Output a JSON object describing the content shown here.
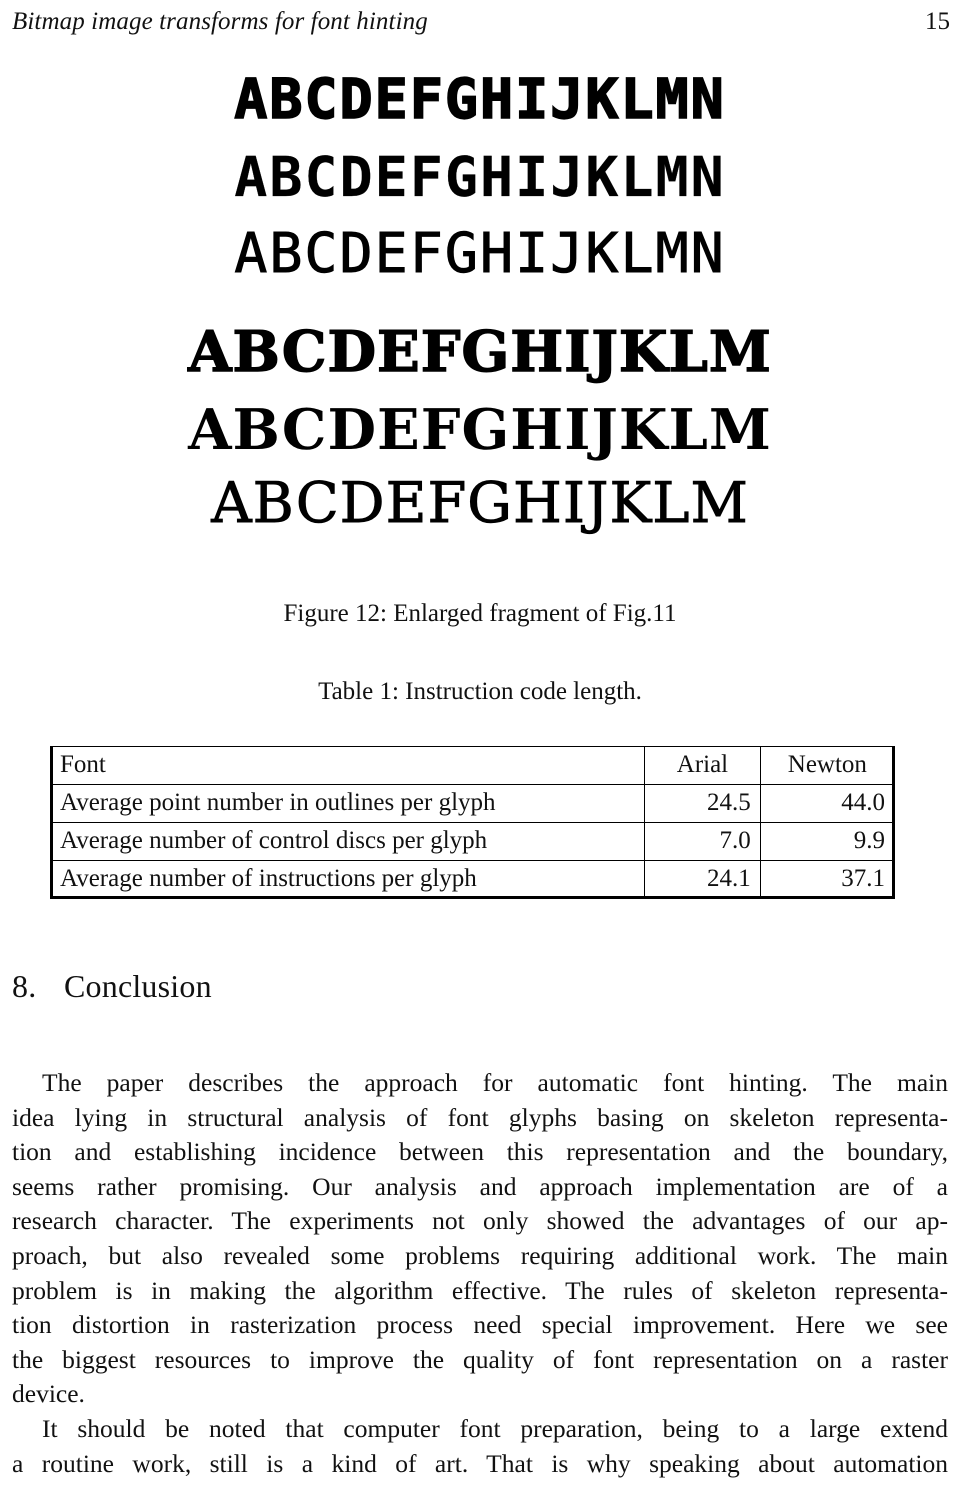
{
  "running_head": {
    "title": "Bitmap image transforms for font hinting",
    "page_number": "15"
  },
  "figure": {
    "rows": [
      {
        "text": "ABCDEFGHIJKLMN",
        "style": "sans-bold"
      },
      {
        "text": "ABCDEFGHIJKLMN",
        "style": "sans-medium"
      },
      {
        "text": "ABCDEFGHIJKLMN",
        "style": "sans-light"
      },
      {
        "text": "ABCDEFGHIJKLM",
        "style": "serif-bold"
      },
      {
        "text": "ABCDEFGHIJKLM",
        "style": "serif-medium"
      },
      {
        "text": "ABCDEFGHIJKLM",
        "style": "serif-light"
      }
    ],
    "caption": "Figure 12: Enlarged fragment of Fig.11"
  },
  "table": {
    "caption": "Table 1: Instruction code length.",
    "headers": [
      "Font",
      "Arial",
      "Newton"
    ],
    "rows": [
      [
        "Average point number in outlines per glyph",
        "24.5",
        "44.0"
      ],
      [
        "Average number of control discs per glyph",
        "7.0",
        "9.9"
      ],
      [
        "Average number of instructions per glyph",
        "24.1",
        "37.1"
      ]
    ]
  },
  "section": {
    "number": "8.",
    "title": "Conclusion"
  },
  "paragraphs": {
    "p1": [
      "The paper describes the approach for automatic font hinting. The main",
      "idea lying in structural analysis of font glyphs basing on skeleton representa-",
      "tion and establishing incidence between this representation and the boundary,",
      "seems rather promising. Our analysis and approach implementation are of a",
      "research character. The experiments not only showed the advantages of our ap-",
      "proach, but also revealed some problems requiring additional work. The main",
      "problem is in making the algorithm effective. The rules of skeleton representa-",
      "tion distortion in rasterization process need special improvement. Here we see",
      "the biggest resources to improve the quality of font representation on a raster",
      "device."
    ],
    "p2": [
      "It should be noted that computer font preparation, being to a large extend",
      "a routine work, still is a kind of art. That is why speaking about automation"
    ]
  }
}
